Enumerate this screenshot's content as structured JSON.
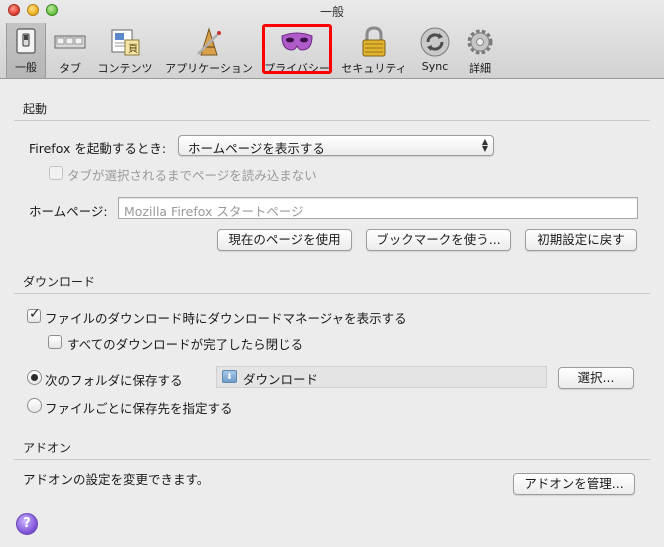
{
  "window": {
    "title": "一般"
  },
  "toolbar": {
    "items": [
      {
        "label": "一般",
        "icon": "general-switch-icon"
      },
      {
        "label": "タブ",
        "icon": "tabs-icon"
      },
      {
        "label": "コンテンツ",
        "icon": "content-icon"
      },
      {
        "label": "アプリケーション",
        "icon": "applications-icon"
      },
      {
        "label": "プライバシー",
        "icon": "privacy-mask-icon"
      },
      {
        "label": "セキュリティ",
        "icon": "security-lock-icon"
      },
      {
        "label": "Sync",
        "icon": "sync-icon"
      },
      {
        "label": "詳細",
        "icon": "advanced-gear-icon"
      }
    ],
    "selected": "一般",
    "highlighted": "プライバシー",
    "highlight_color": "#ff0000"
  },
  "startup": {
    "heading": "起動",
    "when_starts_label": "Firefox を起動するとき:",
    "when_starts_value": "ホームページを表示する",
    "dont_load_tabs_label": "タブが選択されるまでページを読み込まない",
    "dont_load_tabs_checked": false,
    "homepage_label": "ホームページ:",
    "homepage_placeholder": "Mozilla Firefox スタートページ",
    "use_current_button": "現在のページを使用",
    "use_bookmark_button": "ブックマークを使う...",
    "restore_default_button": "初期設定に戻す"
  },
  "downloads": {
    "heading": "ダウンロード",
    "show_manager_label": "ファイルのダウンロード時にダウンロードマネージャを表示する",
    "show_manager_checked": true,
    "close_when_done_label": "すべてのダウンロードが完了したら閉じる",
    "close_when_done_checked": false,
    "save_to_label": "次のフォルダに保存する",
    "save_to_selected": true,
    "folder_name": "ダウンロード",
    "choose_button": "選択...",
    "always_ask_label": "ファイルごとに保存先を指定する",
    "always_ask_selected": false
  },
  "addons": {
    "heading": "アドオン",
    "description": "アドオンの設定を変更できます。",
    "manage_button": "アドオンを管理..."
  },
  "help": {
    "symbol": "?"
  }
}
